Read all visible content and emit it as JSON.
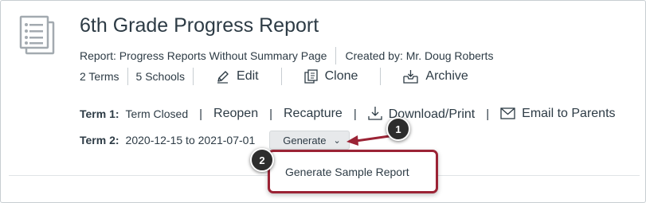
{
  "report": {
    "title": "6th Grade Progress Report",
    "report_type": "Report: Progress Reports Without Summary Page",
    "created_by": "Created by: Mr. Doug Roberts",
    "terms_count": "2 Terms",
    "schools_count": "5 Schools",
    "edit_label": "Edit",
    "clone_label": "Clone",
    "archive_label": "Archive"
  },
  "term1": {
    "label": "Term 1:",
    "status": "Term Closed",
    "reopen": "Reopen",
    "recapture": "Recapture",
    "download": "Download/Print",
    "email": "Email to Parents"
  },
  "term2": {
    "label": "Term 2:",
    "dates": "2020-12-15 to 2021-07-01",
    "generate_label": "Generate"
  },
  "menu": {
    "items": [
      {
        "label": "Generate Sample Report"
      }
    ]
  },
  "callouts": {
    "one": "1",
    "two": "2"
  },
  "colors": {
    "highlight": "#9b2335",
    "text": "#2d3b45",
    "button_bg": "#e7e9eb",
    "callout_bg": "#2d2d2d"
  },
  "icons": [
    "report-document-icon",
    "pencil-icon",
    "clone-icon",
    "archive-icon",
    "download-icon",
    "envelope-icon",
    "chevron-down-icon"
  ]
}
